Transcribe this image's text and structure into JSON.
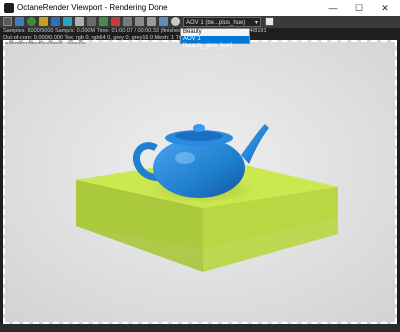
{
  "window": {
    "title": "OctaneRender Viewport - Rendering Done",
    "minimize_glyph": "—",
    "maximize_glyph": "☐",
    "close_glyph": "✕"
  },
  "toolbar": {
    "aov_selected": "AOV 1 (be...plus_hue)",
    "dropdown_chevron": "▾",
    "icons": [
      "region-render-icon",
      "save-icon",
      "refresh-icon",
      "pause-icon",
      "stop-icon",
      "color-icon",
      "lock-icon",
      "grid-icon",
      "display-icon",
      "camera-icon",
      "gear-icon",
      "pin-icon"
    ]
  },
  "dropdown": {
    "options": [
      "Beauty",
      "AOV 1 [beauty_plus_hue]"
    ],
    "selected_index": 1
  },
  "info": {
    "line1": "Samples: 5000/5000   Samp/s: 0.000M   Time: 01:00:07 / 00:00:33 (finished)   GPU Mem (MB): 1393/6294/8191",
    "line2": "Out-of-core: 0.000/0.000   Tex: rgb 0, rgb64 0, grey 0, grey16 0   Mesh: 1   Tri: 6.3k   Path: 100%",
    "line3": "Shd/Hair/Hashes/Voxels: -108/2/0"
  },
  "colors": {
    "teapot": "#1f7fd0",
    "block": "#c6e44a",
    "background": "#e3e3e3",
    "accent": "#0078d7"
  }
}
